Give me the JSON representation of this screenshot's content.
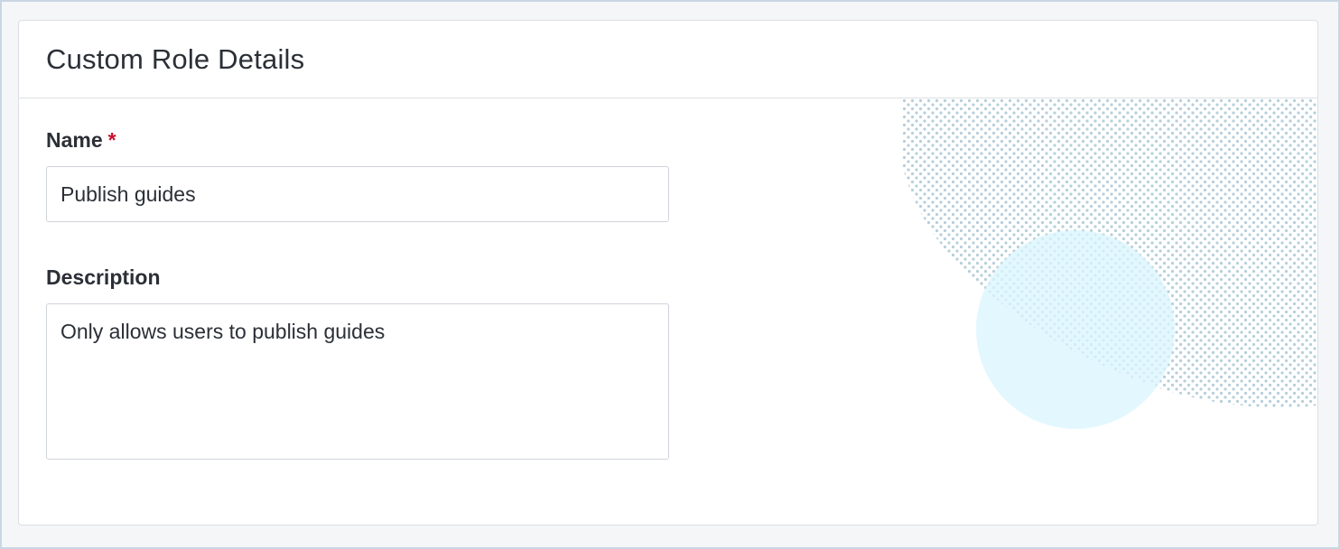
{
  "card": {
    "title": "Custom Role Details"
  },
  "form": {
    "name": {
      "label": "Name",
      "required_marker": "*",
      "value": "Publish guides"
    },
    "description": {
      "label": "Description",
      "value": "Only allows users to publish guides"
    }
  },
  "colors": {
    "required": "#c8102e",
    "dots": "#a9c6d4",
    "circle": "#d9f6fd",
    "border": "#dcdfe4",
    "text": "#2b2f36"
  }
}
